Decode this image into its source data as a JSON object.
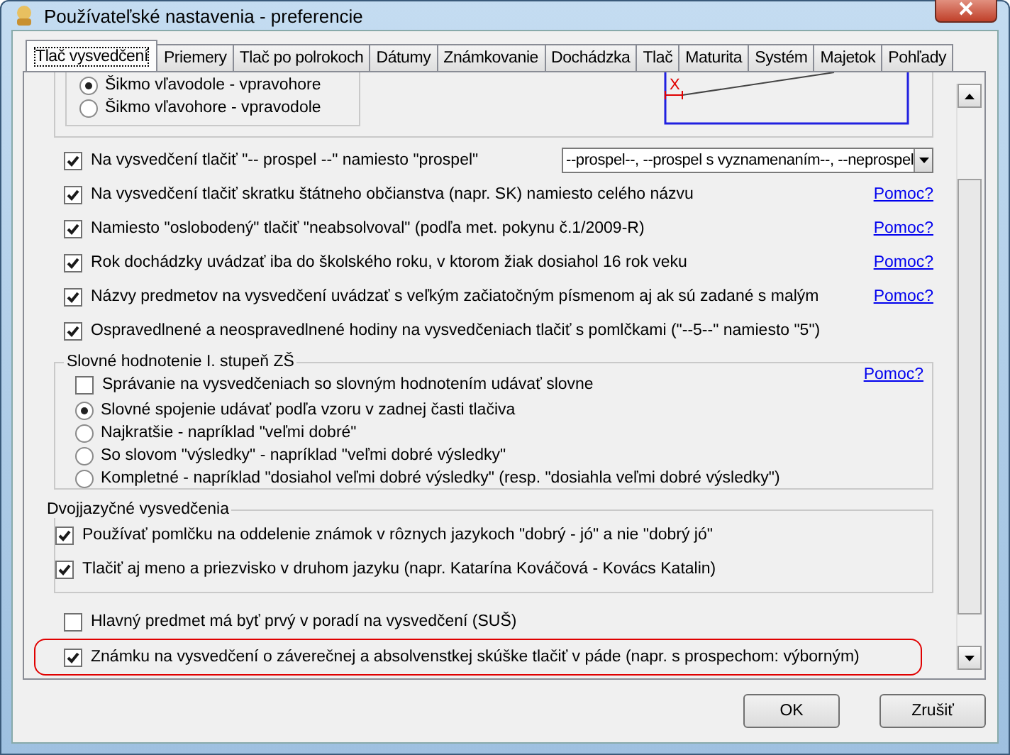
{
  "window": {
    "title": "Používateľské nastavenia - preferencie"
  },
  "tabs": [
    {
      "label": "Tlač vysvedčení",
      "selected": true
    },
    {
      "label": "Priemery",
      "selected": false
    },
    {
      "label": "Tlač po polrokoch",
      "selected": false
    },
    {
      "label": "Dátumy",
      "selected": false
    },
    {
      "label": "Známkovanie",
      "selected": false
    },
    {
      "label": "Dochádzka",
      "selected": false
    },
    {
      "label": "Tlač",
      "selected": false
    },
    {
      "label": "Maturita",
      "selected": false
    },
    {
      "label": "Systém",
      "selected": false
    },
    {
      "label": "Majetok",
      "selected": false
    },
    {
      "label": "Pohľady",
      "selected": false
    }
  ],
  "top_group": {
    "options": [
      {
        "label": "Šikmo vľavodole - vpravohore",
        "selected": true
      },
      {
        "label": "Šikmo vľavohore - vpravodole",
        "selected": false
      }
    ]
  },
  "diagram": {
    "marker": "X"
  },
  "options": [
    {
      "label": "Na vysvedčení tlačiť \"-- prospel --\" namiesto \"prospel\"",
      "checked": true,
      "dropdown": "--prospel--, --prospel s vyznamenaním--, --neprospel"
    },
    {
      "label": "Na vysvedčení tlačiť skratku štátneho občianstva (napr. SK) namiesto celého názvu",
      "checked": true,
      "help": "Pomoc?"
    },
    {
      "label": "Namiesto \"oslobodený\" tlačiť \"neabsolvoval\" (podľa met. pokynu č.1/2009-R)",
      "checked": true,
      "help": "Pomoc?"
    },
    {
      "label": "Rok dochádzky uvádzať iba do školského roku, v ktorom žiak dosiahol 16 rok veku",
      "checked": true,
      "help": "Pomoc?"
    },
    {
      "label": "Názvy predmetov na vysvedčení uvádzať s veľkým začiatočným písmenom aj ak sú zadané s malým",
      "checked": true,
      "help": "Pomoc?"
    },
    {
      "label": "Ospravedlnené a neospravedlnené hodiny na vysvedčeniach tlačiť s pomlčkami (\"--5--\" namiesto \"5\")",
      "checked": true
    }
  ],
  "word_group": {
    "title": "Slovné hodnotenie I. stupeň ZŠ",
    "help": "Pomoc?",
    "items": [
      {
        "kind": "checkbox",
        "label": "Správanie na vysvedčeniach so slovným hodnotením udávať slovne",
        "checked": false
      },
      {
        "kind": "radio",
        "label": "Slovné spojenie udávať podľa vzoru v zadnej časti tlačiva",
        "selected": true
      },
      {
        "kind": "radio",
        "label": "Najkratšie - napríklad \"veľmi dobré\"",
        "selected": false
      },
      {
        "kind": "radio",
        "label": "So slovom \"výsledky\" - napríklad \"veľmi dobré výsledky\"",
        "selected": false
      },
      {
        "kind": "radio",
        "label": "Kompletné - napríklad \"dosiahol veľmi dobré výsledky\" (resp. \"dosiahla veľmi dobré výsledky\")",
        "selected": false
      }
    ]
  },
  "bilingual_group": {
    "title": "Dvojjazyčné vysvedčenia",
    "items": [
      {
        "label": "Používať pomlčku na oddelenie známok v rôznych jazykoch \"dobrý - jó\" a nie \"dobrý jó\"",
        "checked": true
      },
      {
        "label": "Tlačiť aj meno a priezvisko v druhom jazyku (napr. Katarína Kováčová - Kovács Katalin)",
        "checked": true
      }
    ]
  },
  "bottom_options": [
    {
      "label": "Hlavný predmet má byť prvý v poradí na vysvedčení (SUŠ)",
      "checked": false,
      "highlighted": false
    },
    {
      "label": "Známku na vysvedčení o záverečnej a absolvenstkej skúške tlačiť v páde (napr. s prospechom: výborným)",
      "checked": true,
      "highlighted": true
    }
  ],
  "buttons": [
    {
      "label": "OK"
    },
    {
      "label": "Zrušiť"
    }
  ]
}
